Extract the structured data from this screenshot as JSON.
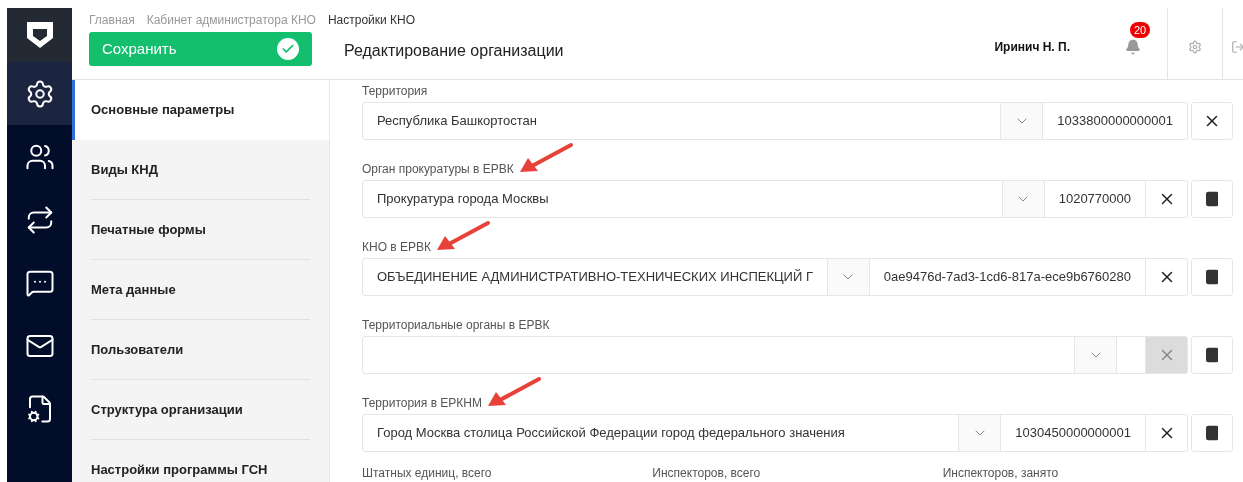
{
  "breadcrumbs": [
    {
      "label": "Главная",
      "current": false
    },
    {
      "label": "Кабинет администратора КНО",
      "current": false
    },
    {
      "label": "Настройки КНО",
      "current": true
    }
  ],
  "save_button": {
    "label": "Сохранить"
  },
  "page_title": "Редактирование организации",
  "user": {
    "name": "Иринич Н. П.",
    "notifications": "20"
  },
  "rail": [
    {
      "kind": "settings",
      "selected": true
    },
    {
      "kind": "people",
      "selected": false
    },
    {
      "kind": "people-switch",
      "selected": false
    },
    {
      "kind": "chat",
      "selected": false
    },
    {
      "kind": "mail",
      "selected": false
    },
    {
      "kind": "report",
      "selected": false
    }
  ],
  "nav": [
    {
      "label": "Основные параметры",
      "selected": true
    },
    {
      "label": "Виды КНД",
      "selected": false
    },
    {
      "label": "Печатные формы",
      "selected": false
    },
    {
      "label": "Мета данные",
      "selected": false
    },
    {
      "label": "Пользователи",
      "selected": false
    },
    {
      "label": "Структура организации",
      "selected": false
    },
    {
      "label": "Настройки программы ГСН",
      "selected": false
    }
  ],
  "fields": [
    {
      "label": "Территория",
      "value": "Республика Башкортостан",
      "code": "1033800000000001",
      "clear_disabled": false,
      "has_book": false,
      "annotated": false
    },
    {
      "label": "Орган прокуратуры в ЕРВК",
      "value": "Прокуратура города Москвы",
      "code": "1020770000",
      "clear_disabled": false,
      "has_book": true,
      "annotated": true
    },
    {
      "label": "КНО в ЕРВК",
      "value": "ОБЪЕДИНЕНИЕ АДМИНИСТРАТИВНО-ТЕХНИЧЕСКИХ ИНСПЕКЦИЙ Г",
      "code": "0ae9476d-7ad3-1cd6-817a-ece9b6760280",
      "clear_disabled": false,
      "has_book": true,
      "annotated": true
    },
    {
      "label": "Территориальные органы в ЕРВК",
      "clear_disabled": true,
      "has_book": true,
      "annotated": false
    },
    {
      "label": "Территория в ЕРКНМ",
      "value": "Город Москва столица Российской Федерации город федерального значения",
      "code": "1030450000000001",
      "clear_disabled": false,
      "has_book": true,
      "annotated": true
    }
  ],
  "bottom_labels": [
    "Штатных единиц, всего",
    "Инспекторов, всего",
    "Инспекторов, занято"
  ]
}
